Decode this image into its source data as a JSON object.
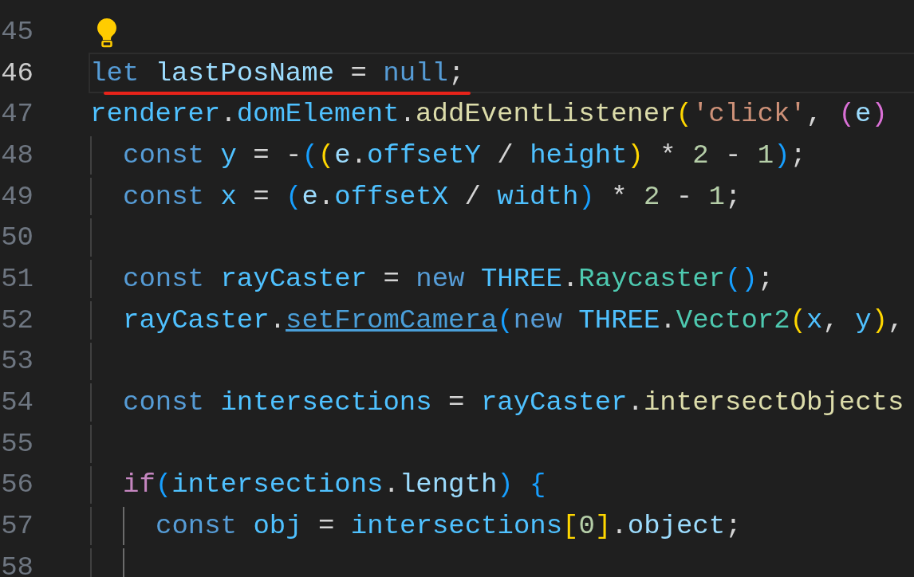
{
  "lines": [
    {
      "number": "45",
      "active": false,
      "lightbulb": true
    },
    {
      "number": "46",
      "active": true,
      "underlined": true,
      "tokens": [
        {
          "kind": "keyword",
          "text": "let "
        },
        {
          "kind": "variable",
          "text": "lastPosName"
        },
        {
          "kind": "plain",
          "text": " = "
        },
        {
          "kind": "keyword",
          "text": "null"
        },
        {
          "kind": "plain",
          "text": ";"
        }
      ]
    },
    {
      "number": "47",
      "active": false,
      "tokens": [
        {
          "kind": "constant",
          "text": "renderer"
        },
        {
          "kind": "plain",
          "text": "."
        },
        {
          "kind": "constant",
          "text": "domElement"
        },
        {
          "kind": "plain",
          "text": "."
        },
        {
          "kind": "function",
          "text": "addEventListener"
        },
        {
          "kind": "bracket1",
          "text": "("
        },
        {
          "kind": "string",
          "text": "'click'"
        },
        {
          "kind": "plain",
          "text": ", "
        },
        {
          "kind": "bracket2",
          "text": "("
        },
        {
          "kind": "variable",
          "text": "e"
        },
        {
          "kind": "bracket2",
          "text": ")"
        }
      ],
      "children": [
        {
          "number": "48",
          "active": false,
          "tokens": [
            {
              "kind": "keyword",
              "text": "const "
            },
            {
              "kind": "constant",
              "text": "y"
            },
            {
              "kind": "plain",
              "text": " = -"
            },
            {
              "kind": "bracket3",
              "text": "("
            },
            {
              "kind": "bracket1",
              "text": "("
            },
            {
              "kind": "variable",
              "text": "e"
            },
            {
              "kind": "plain",
              "text": "."
            },
            {
              "kind": "constant",
              "text": "offsetY"
            },
            {
              "kind": "plain",
              "text": " / "
            },
            {
              "kind": "constant",
              "text": "height"
            },
            {
              "kind": "bracket1",
              "text": ")"
            },
            {
              "kind": "plain",
              "text": " * "
            },
            {
              "kind": "number",
              "text": "2"
            },
            {
              "kind": "plain",
              "text": " - "
            },
            {
              "kind": "number",
              "text": "1"
            },
            {
              "kind": "bracket3",
              "text": ")"
            },
            {
              "kind": "plain",
              "text": ";"
            }
          ]
        },
        {
          "number": "49",
          "active": false,
          "tokens": [
            {
              "kind": "keyword",
              "text": "const "
            },
            {
              "kind": "constant",
              "text": "x"
            },
            {
              "kind": "plain",
              "text": " = "
            },
            {
              "kind": "bracket3",
              "text": "("
            },
            {
              "kind": "variable",
              "text": "e"
            },
            {
              "kind": "plain",
              "text": "."
            },
            {
              "kind": "constant",
              "text": "offsetX"
            },
            {
              "kind": "plain",
              "text": " / "
            },
            {
              "kind": "constant",
              "text": "width"
            },
            {
              "kind": "bracket3",
              "text": ")"
            },
            {
              "kind": "plain",
              "text": " * "
            },
            {
              "kind": "number",
              "text": "2"
            },
            {
              "kind": "plain",
              "text": " - "
            },
            {
              "kind": "number",
              "text": "1"
            },
            {
              "kind": "plain",
              "text": ";"
            }
          ]
        },
        {
          "number": "50",
          "active": false
        },
        {
          "number": "51",
          "active": false,
          "tokens": [
            {
              "kind": "keyword",
              "text": "const "
            },
            {
              "kind": "constant",
              "text": "rayCaster"
            },
            {
              "kind": "plain",
              "text": " = "
            },
            {
              "kind": "keyword",
              "text": "new "
            },
            {
              "kind": "constant",
              "text": "THREE"
            },
            {
              "kind": "plain",
              "text": "."
            },
            {
              "kind": "class",
              "text": "Raycaster"
            },
            {
              "kind": "bracket3",
              "text": "()"
            },
            {
              "kind": "plain",
              "text": ";"
            }
          ]
        },
        {
          "number": "52",
          "active": false,
          "tokens": [
            {
              "kind": "constant",
              "text": "rayCaster"
            },
            {
              "kind": "plain",
              "text": "."
            },
            {
              "kind": "link",
              "text": "setFromCamera"
            },
            {
              "kind": "bracket3",
              "text": "("
            },
            {
              "kind": "keyword",
              "text": "new "
            },
            {
              "kind": "constant",
              "text": "THREE"
            },
            {
              "kind": "plain",
              "text": "."
            },
            {
              "kind": "class",
              "text": "Vector2"
            },
            {
              "kind": "bracket1",
              "text": "("
            },
            {
              "kind": "constant",
              "text": "x"
            },
            {
              "kind": "plain",
              "text": ", "
            },
            {
              "kind": "constant",
              "text": "y"
            },
            {
              "kind": "bracket1",
              "text": ")"
            },
            {
              "kind": "plain",
              "text": ","
            }
          ]
        },
        {
          "number": "53",
          "active": false
        },
        {
          "number": "54",
          "active": false,
          "tokens": [
            {
              "kind": "keyword",
              "text": "const "
            },
            {
              "kind": "constant",
              "text": "intersections"
            },
            {
              "kind": "plain",
              "text": " = "
            },
            {
              "kind": "constant",
              "text": "rayCaster"
            },
            {
              "kind": "plain",
              "text": "."
            },
            {
              "kind": "function",
              "text": "intersectObjects"
            }
          ]
        },
        {
          "number": "55",
          "active": false
        },
        {
          "number": "56",
          "active": false,
          "scope_active": true,
          "tokens": [
            {
              "kind": "control",
              "text": "if"
            },
            {
              "kind": "bracket3",
              "text": "("
            },
            {
              "kind": "constant",
              "text": "intersections"
            },
            {
              "kind": "plain",
              "text": "."
            },
            {
              "kind": "variable",
              "text": "length"
            },
            {
              "kind": "bracket3",
              "text": ")"
            },
            {
              "kind": "bracket3",
              "text": " {"
            }
          ],
          "children": [
            {
              "number": "57",
              "active": false,
              "tokens": [
                {
                  "kind": "keyword",
                  "text": "const "
                },
                {
                  "kind": "constant",
                  "text": "obj"
                },
                {
                  "kind": "plain",
                  "text": " = "
                },
                {
                  "kind": "constant",
                  "text": "intersections"
                },
                {
                  "kind": "bracket1",
                  "text": "["
                },
                {
                  "kind": "number",
                  "text": "0"
                },
                {
                  "kind": "bracket1",
                  "text": "]"
                },
                {
                  "kind": "plain",
                  "text": "."
                },
                {
                  "kind": "variable",
                  "text": "object"
                },
                {
                  "kind": "plain",
                  "text": ";"
                }
              ]
            },
            {
              "number": "58",
              "active": false
            }
          ]
        }
      ]
    }
  ]
}
